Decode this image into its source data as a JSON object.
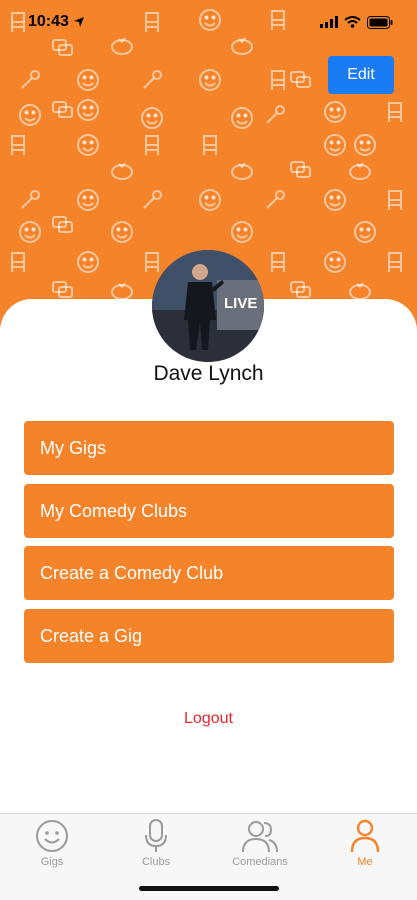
{
  "status_bar": {
    "time": "10:43"
  },
  "header": {
    "edit_label": "Edit"
  },
  "profile": {
    "name": "Dave Lynch",
    "avatar_overlay_text": "LIVE"
  },
  "menu": {
    "items": [
      {
        "label": "My Gigs"
      },
      {
        "label": "My Comedy Clubs"
      },
      {
        "label": "Create a Comedy Club"
      },
      {
        "label": "Create a Gig"
      }
    ]
  },
  "logout_label": "Logout",
  "tabbar": {
    "tabs": [
      {
        "label": "Gigs",
        "icon": "smiley-icon"
      },
      {
        "label": "Clubs",
        "icon": "microphone-icon"
      },
      {
        "label": "Comedians",
        "icon": "people-icon"
      },
      {
        "label": "Me",
        "icon": "person-icon"
      }
    ],
    "active_index": 3
  },
  "colors": {
    "brand_orange": "#f5832a",
    "edit_blue": "#1a7cf5",
    "logout_red": "#e8262d"
  }
}
